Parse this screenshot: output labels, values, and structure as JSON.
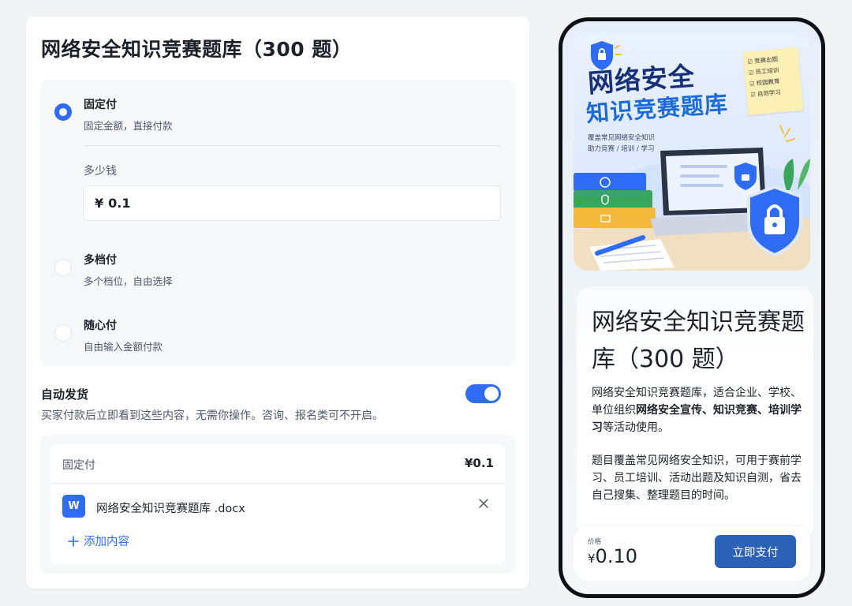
{
  "product": {
    "title": "网络安全知识竞赛题库（300 题）"
  },
  "payment": {
    "options": [
      {
        "title": "固定付",
        "desc": "固定金额，直接付款",
        "selected": true
      },
      {
        "title": "多档付",
        "desc": "多个档位，自由选择",
        "selected": false
      },
      {
        "title": "随心付",
        "desc": "自由输入金额付款",
        "selected": false
      }
    ],
    "amount_label": "多少钱",
    "currency_symbol": "¥",
    "amount_value": "0.1"
  },
  "auto_delivery": {
    "title": "自动发货",
    "desc": "买家付款后立即看到这些内容，无需你操作。咨询、报名类可不开启。",
    "enabled": true,
    "tier_label": "固定付",
    "tier_price": "¥0.1",
    "file_icon_letter": "W",
    "file_name": "网络安全知识竞赛题库 .docx",
    "add_content_label": "添加内容"
  },
  "preview": {
    "hero": {
      "title_line1": "网络安全",
      "title_line2": "知识竞赛题库",
      "subtitle_line1": "覆盖常见网络安全知识",
      "subtitle_line2": "助力竞赛 / 培训 / 学习",
      "note_items": [
        "竞赛出题",
        "员工培训",
        "校园教育",
        "自测学习"
      ]
    },
    "title": "网络安全知识竞赛题库（300 题）",
    "para1_a": "网络安全知识竞赛题库，适合企业、学校、单位组织",
    "para1_b": "网络安全宣传、知识竞赛、培训学习",
    "para1_c": "等活动使用。",
    "para2": "题目覆盖常见网络安全知识，可用于赛前学习、员工培训、活动出题及知识自测，省去自己搜集、整理题目的时间。",
    "price_label": "价格",
    "price_currency": "¥",
    "price_value": "0.10",
    "pay_button": "立即支付"
  },
  "colors": {
    "accent": "#2f6cf6",
    "pay_button": "#2b62b8",
    "phone_frame": "#0d1117"
  }
}
